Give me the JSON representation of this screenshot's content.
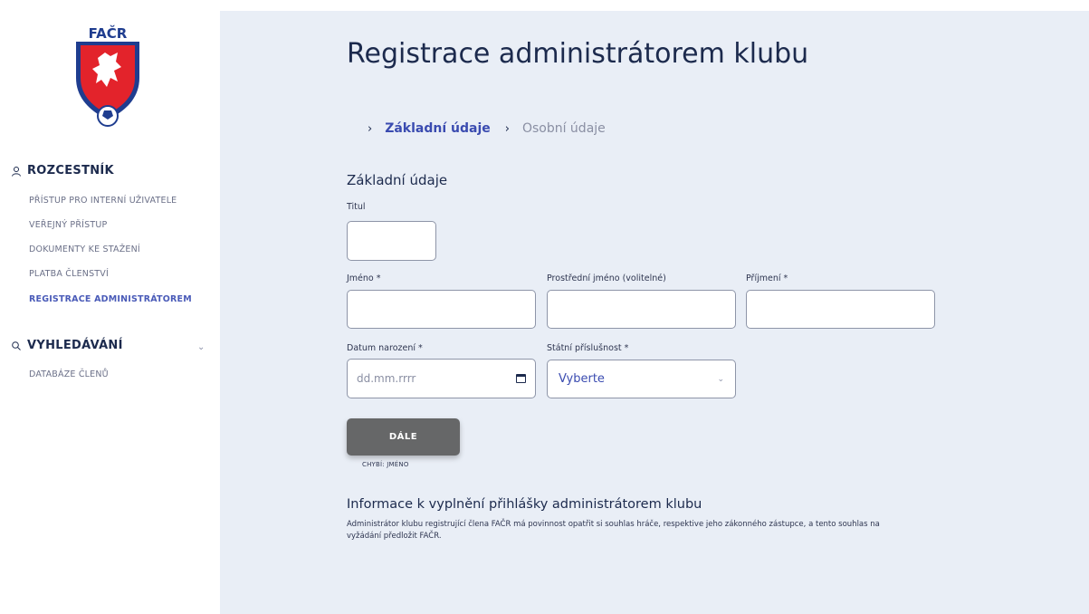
{
  "sidebar": {
    "logo_text": "FAČR",
    "sections": [
      {
        "icon": "user-icon",
        "label": "ROZCESTNÍK",
        "items": [
          {
            "label": "PŘÍSTUP PRO INTERNÍ UŽIVATELE",
            "active": false
          },
          {
            "label": "VEŘEJNÝ PŘÍSTUP",
            "active": false
          },
          {
            "label": "DOKUMENTY KE STAŽENÍ",
            "active": false
          },
          {
            "label": "PLATBA ČLENSTVÍ",
            "active": false
          },
          {
            "label": "REGISTRACE ADMINISTRÁTOREM",
            "active": true
          }
        ]
      },
      {
        "icon": "search-icon",
        "label": "VYHLEDÁVÁNÍ",
        "expand_icon": "chevron-down-icon",
        "items": [
          {
            "label": "DATABÁZE ČLENŮ",
            "active": false
          }
        ]
      }
    ]
  },
  "main": {
    "title": "Registrace administrátorem klubu",
    "steps": [
      {
        "label": "Základní údaje",
        "active": true
      },
      {
        "label": "Osobní údaje",
        "active": false
      }
    ],
    "section_title": "Základní údaje",
    "form": {
      "title_label": "Titul",
      "title_value": "",
      "first_name_label": "Jméno *",
      "first_name_value": "",
      "middle_name_label": "Prostřední jméno (volitelné)",
      "middle_name_value": "",
      "last_name_label": "Příjmení *",
      "last_name_value": "",
      "birth_date_label": "Datum narození *",
      "birth_date_placeholder": "dd.mm.rrrr",
      "nationality_label": "Státní příslušnost *",
      "nationality_selected": "Vyberte"
    },
    "next_button": "DÁLE",
    "missing_note": "CHYBÍ: JMÉNO",
    "info_title": "Informace k vyplnění přihlášky administrátorem klubu",
    "info_text": "Administrátor klubu registrující člena FAČR má povinnost opatřit si souhlas hráče, respektive jeho zákonného zástupce, a tento souhlas na vyžádání předložit FAČR."
  },
  "colors": {
    "accent": "#3a4bb0",
    "navy": "#1c2a4d",
    "main_bg": "#e9eef6",
    "button_bg": "#666768",
    "logo_red": "#e3232b",
    "logo_blue": "#1f3d8f"
  }
}
